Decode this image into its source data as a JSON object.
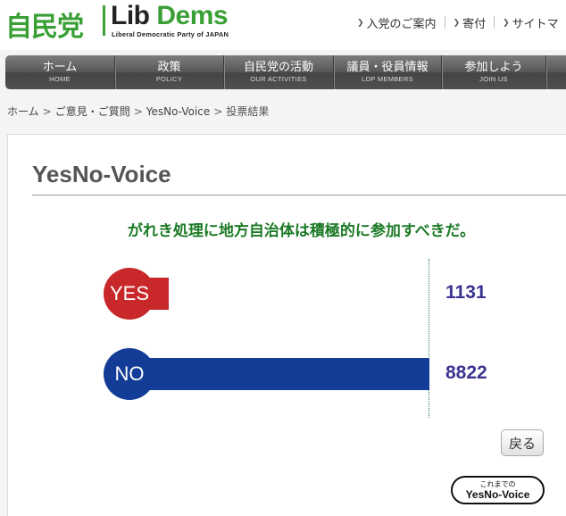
{
  "header": {
    "logo_jp": "自民党",
    "logo_en_main": "Lib",
    "logo_en_accent": "Dems",
    "logo_sub": "Liberal Democratic Party of JAPAN",
    "links": [
      {
        "label": "入党のご案内"
      },
      {
        "label": "寄付"
      },
      {
        "label": "サイトマ"
      }
    ]
  },
  "nav": {
    "items": [
      {
        "jp": "ホーム",
        "en": "HOME"
      },
      {
        "jp": "政策",
        "en": "POLICY"
      },
      {
        "jp": "自民党の活動",
        "en": "OUR ACTIVITIES"
      },
      {
        "jp": "議員・役員情報",
        "en": "LDP MEMBERS"
      },
      {
        "jp": "参加しよう",
        "en": "JOIN US"
      }
    ]
  },
  "breadcrumb": {
    "items": [
      "ホーム",
      "ご意見・ご質問",
      "YesNo-Voice",
      "投票結果"
    ]
  },
  "main": {
    "title": "YesNo-Voice",
    "question": "がれき処理に地方自治体は積極的に参加すべきだ。",
    "back_label": "戻る",
    "archive_small": "これまでの",
    "archive_large": "YesNo-Voice"
  },
  "chart_data": {
    "type": "bar",
    "categories": [
      "YES",
      "NO"
    ],
    "values": [
      1131,
      8822
    ],
    "colors": {
      "YES": "#c8282a",
      "NO": "#123c96"
    }
  }
}
